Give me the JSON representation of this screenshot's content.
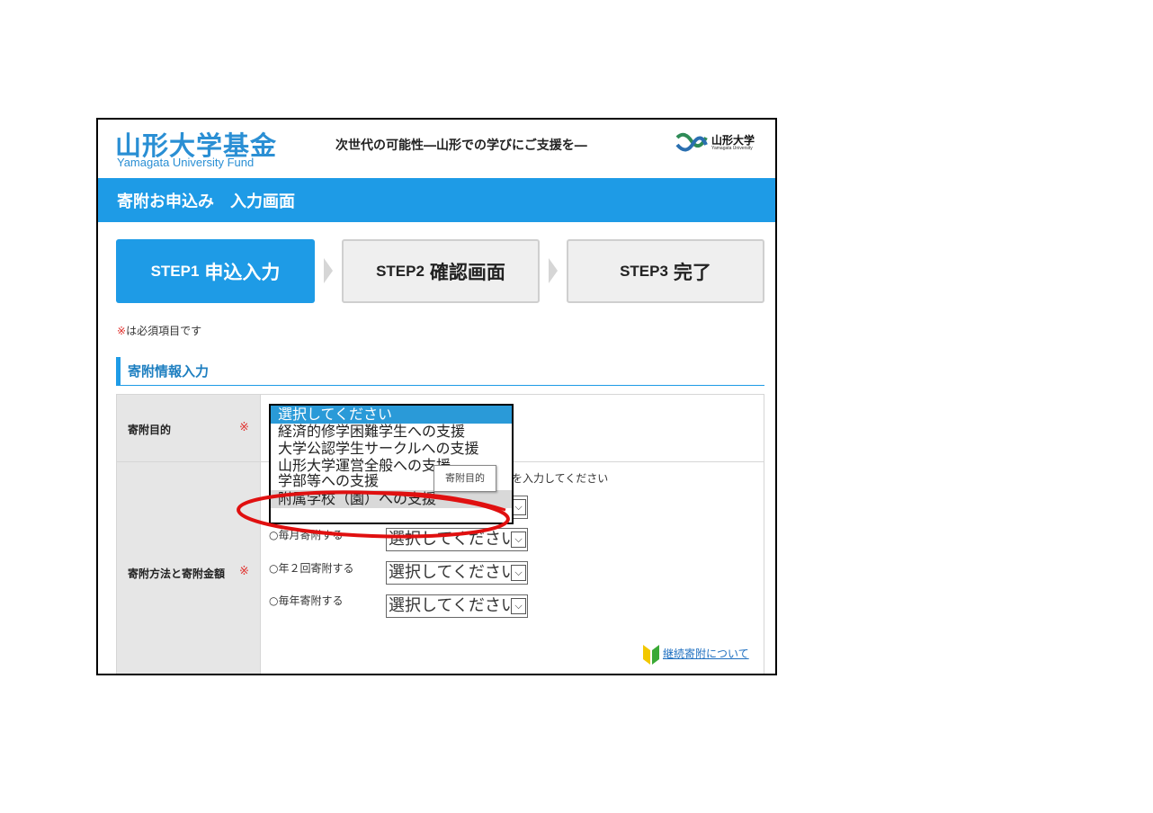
{
  "header": {
    "logo_jp": "山形大学基金",
    "logo_en": "Yamagata University Fund",
    "tagline": "次世代の可能性―山形での学びにご支援を―",
    "univ_name": "山形大学",
    "univ_sub": "Yamagata University"
  },
  "page_title": "寄附お申込み　入力画面",
  "steps": [
    {
      "en": "STEP1",
      "jp": "申込入力",
      "active": true
    },
    {
      "en": "STEP2",
      "jp": "確認画面",
      "active": false
    },
    {
      "en": "STEP3",
      "jp": "完了",
      "active": false
    }
  ],
  "required_note": {
    "mark": "※",
    "text": "は必須項目です"
  },
  "section_title": "寄附情報入力",
  "form": {
    "purpose_label": "寄附目的",
    "method_label": "寄附方法と寄附金額",
    "required_mark": "※",
    "hint": "を入力してください",
    "radio_options": [
      "毎月寄附する",
      "年２回寄附する",
      "毎年寄附する"
    ],
    "select_placeholder": "選択してください",
    "link_continuing": "継続寄附について"
  },
  "dropdown": {
    "options": [
      "選択してください",
      "経済的修学困難学生への支援",
      "大学公認学生サークルへの支援",
      "山形大学運営全般への支援",
      "学部等への支援",
      "附属学校（園）への支援"
    ],
    "selected_index": 0,
    "highlighted_index": 5
  },
  "tooltip": "寄附目的",
  "colors": {
    "accent": "#1e9be6",
    "required": "#e0312d",
    "annotation": "#e01010"
  }
}
